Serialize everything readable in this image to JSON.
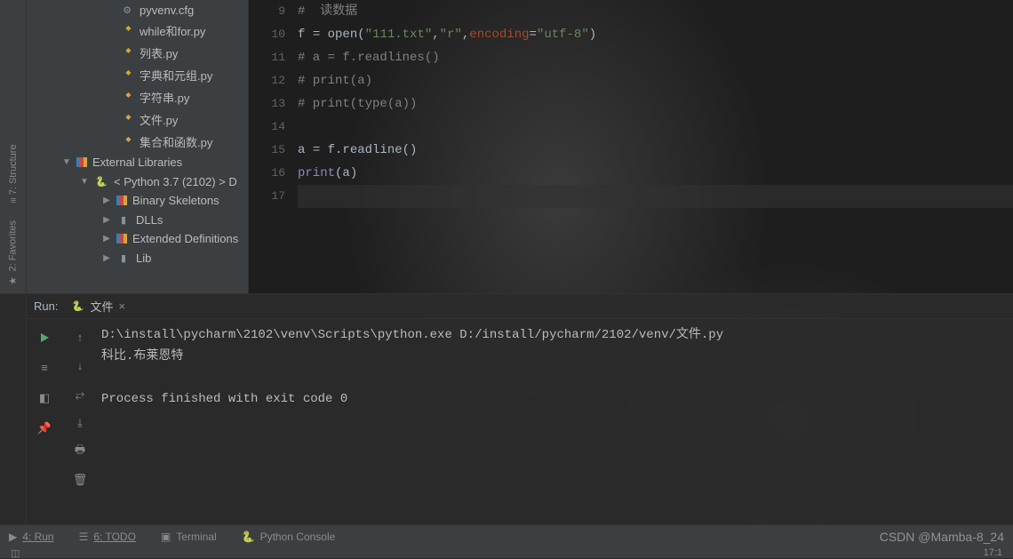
{
  "project": {
    "files": [
      {
        "icon": "cfg",
        "name": "pyvenv.cfg"
      },
      {
        "icon": "py",
        "name": "while和for.py"
      },
      {
        "icon": "py",
        "name": "列表.py"
      },
      {
        "icon": "py",
        "name": "字典和元组.py"
      },
      {
        "icon": "py",
        "name": "字符串.py"
      },
      {
        "icon": "py",
        "name": "文件.py"
      },
      {
        "icon": "py",
        "name": "集合和函数.py"
      }
    ],
    "ext_lib_label": "External Libraries",
    "interpreter_label": "< Python 3.7 (2102) >  D",
    "subs": [
      {
        "icon": "lib",
        "name": "Binary Skeletons"
      },
      {
        "icon": "folder",
        "name": "DLLs"
      },
      {
        "icon": "lib",
        "name": "Extended Definitions"
      },
      {
        "icon": "folder",
        "name": "Lib"
      }
    ]
  },
  "editor": {
    "lines": [
      {
        "n": "9",
        "html": "<span class='c-cmt'>#  读数据</span>"
      },
      {
        "n": "10",
        "html": "f <span class='c-eq'>=</span> <span class='c-fn'>open</span>(<span class='c-str'>\"111.txt\"</span>,<span class='c-str'>\"r\"</span>,<span class='c-kwarg'>encoding</span>=<span class='c-str'>\"utf-8\"</span>)"
      },
      {
        "n": "11",
        "html": "<span class='c-cmt'># a = f.readlines()</span>"
      },
      {
        "n": "12",
        "html": "<span class='c-cmt'># print(a)</span>"
      },
      {
        "n": "13",
        "html": "<span class='c-cmt'># print(type(a))</span>"
      },
      {
        "n": "14",
        "html": ""
      },
      {
        "n": "15",
        "html": "a <span class='c-eq'>=</span> f.readline()"
      },
      {
        "n": "16",
        "html": "<span class='c-print'>print</span>(a)"
      },
      {
        "n": "17",
        "html": ""
      }
    ]
  },
  "run": {
    "label": "Run:",
    "tab_name": "文件",
    "output": [
      "D:\\install\\pycharm\\2102\\venv\\Scripts\\python.exe D:/install/pycharm/2102/venv/文件.py",
      "科比.布莱恩特",
      "",
      "Process finished with exit code 0"
    ]
  },
  "sidebar": {
    "structure": "7: Structure",
    "favorites": "2: Favorites"
  },
  "bottombar": {
    "run": "4: Run",
    "todo": "6: TODO",
    "terminal": "Terminal",
    "pyconsole": "Python Console"
  },
  "status": {
    "pos": "17:1"
  },
  "watermark": "CSDN @Mamba-8_24"
}
